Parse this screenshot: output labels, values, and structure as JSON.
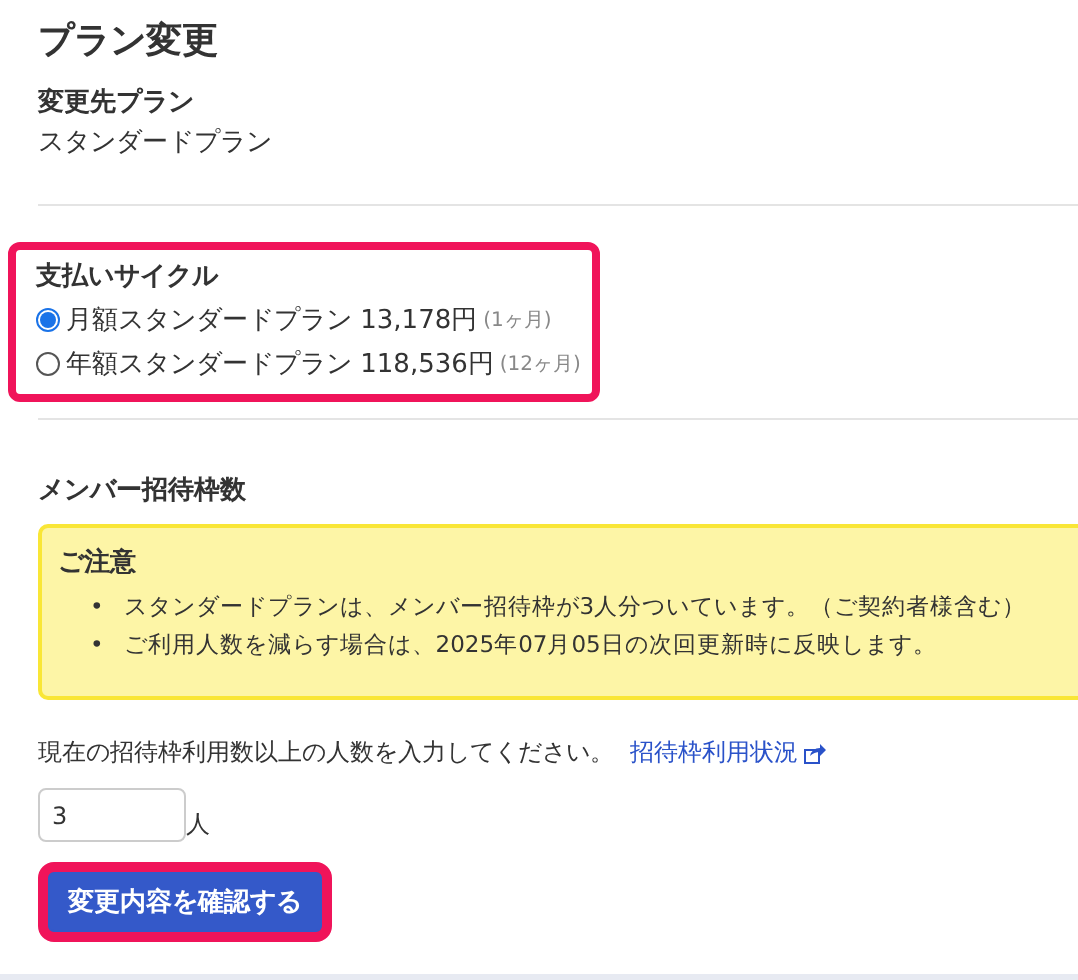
{
  "title": "プラン変更",
  "target_plan": {
    "label": "変更先プラン",
    "value": "スタンダードプラン"
  },
  "payment_cycle": {
    "heading": "支払いサイクル",
    "options": [
      {
        "label": "月額スタンダードプラン 13,178円",
        "note": "(1ヶ月)",
        "selected": true
      },
      {
        "label": "年額スタンダードプラン 118,536円",
        "note": "(12ヶ月)",
        "selected": false
      }
    ]
  },
  "members": {
    "heading": "メンバー招待枠数",
    "notice": {
      "title": "ご注意",
      "items": [
        {
          "bullet": "•",
          "text": "スタンダードプランは、メンバー招待枠が3人分ついています。（ご契約者様含む）"
        },
        {
          "bullet": "•",
          "text": "ご利用人数を減らす場合は、2025年07月05日の次回更新時に反映します。"
        }
      ]
    },
    "instruction": "現在の招待枠利用数以上の人数を入力してください。",
    "link": "招待枠利用状況",
    "count": "3",
    "unit": "人"
  },
  "confirm_button": "変更内容を確認する"
}
